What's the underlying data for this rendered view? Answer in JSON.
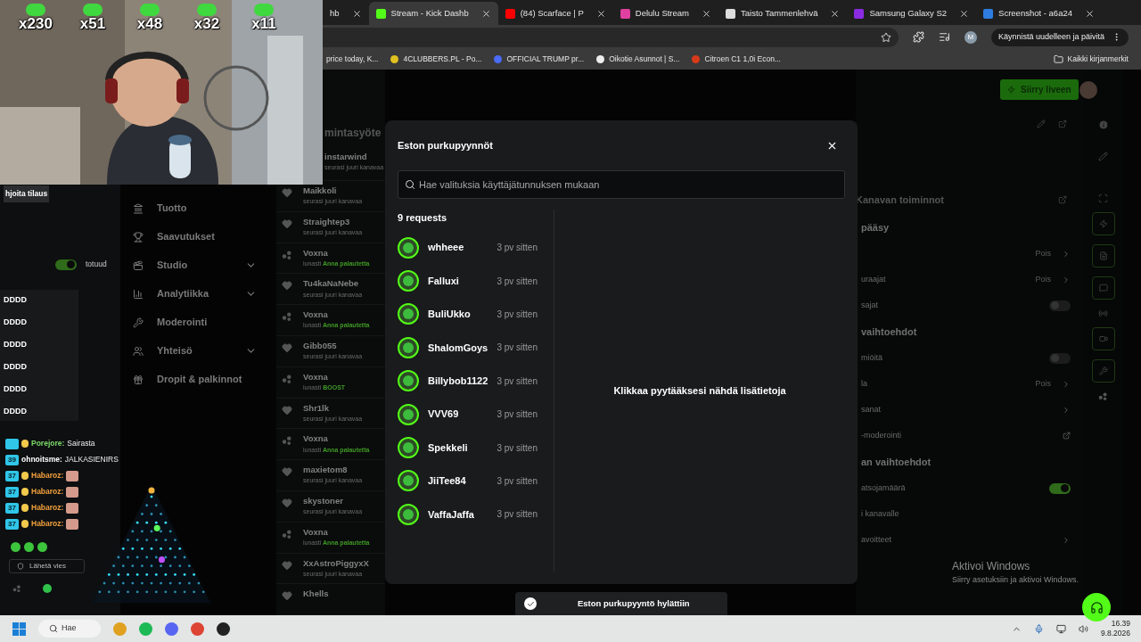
{
  "browser": {
    "tabs": [
      {
        "title": "hb",
        "selected": false
      },
      {
        "title": "Stream - Kick Dashb",
        "selected": true
      },
      {
        "title": "(84) Scarface | P",
        "selected": false
      },
      {
        "title": "Delulu Stream",
        "selected": false
      },
      {
        "title": "Taisto Tammenlehvä",
        "selected": false
      },
      {
        "title": "Samsung Galaxy S2",
        "selected": false
      },
      {
        "title": "Screenshot - a6a24",
        "selected": false
      }
    ],
    "update_button": "Käynnistä uudelleen ja päivitä",
    "profile_initial": "M",
    "bookmarks": [
      "price today, K...",
      "4CLUBBERS.PL - Po...",
      "OFFICIAL TRUMP pr...",
      "Oikotie Asunnot | S...",
      "Citroen C1 1,0i Econ..."
    ],
    "all_bookmarks": "Kaikki kirjanmerkit"
  },
  "webcam": {
    "counters": [
      "x230",
      "x51",
      "x48",
      "x32",
      "x11"
    ]
  },
  "chat_panel": {
    "popup": "hjoita tilaus",
    "toggle_on": true,
    "side_text": "totuud",
    "list": [
      "DDDD",
      "DDDD",
      "DDDD",
      "DDDD",
      "DDDD",
      "DDDD"
    ],
    "messages": [
      {
        "user": "Porejore:",
        "text": "Sairasta",
        "color": "#7cd96a"
      },
      {
        "badge": "39",
        "user": "ohnoitsme:",
        "text": "JALKASIENIRS",
        "color": "#ffffff"
      },
      {
        "badge": "37",
        "user": "Habaroz:",
        "color": "#f2a03d"
      },
      {
        "badge": "37",
        "user": "Habaroz:",
        "color": "#f2a03d"
      },
      {
        "badge": "37",
        "user": "Habaroz:",
        "color": "#f2a03d"
      },
      {
        "badge": "37",
        "user": "Habaroz:",
        "color": "#f2a03d"
      }
    ],
    "input_placeholder": "Lähetä vies"
  },
  "nav": [
    {
      "label": "Tuotto",
      "expandable": false
    },
    {
      "label": "Saavutukset",
      "expandable": false
    },
    {
      "label": "Studio",
      "expandable": true
    },
    {
      "label": "Analytiikka",
      "expandable": true
    },
    {
      "label": "Moderointi",
      "expandable": false
    },
    {
      "label": "Yhteisö",
      "expandable": true
    },
    {
      "label": "Dropit & palkinnot",
      "expandable": false
    }
  ],
  "activity": {
    "title": "mintasyöte",
    "items": [
      {
        "kind": "follow",
        "user": "instarwind",
        "text": "seurasi juuri kanavaa"
      },
      {
        "kind": "follow",
        "user": "Maikkoli",
        "text": "seurasi juuri kanavaa"
      },
      {
        "kind": "follow",
        "user": "Straightep3",
        "text": "seurasi juuri kanavaa"
      },
      {
        "kind": "redeem",
        "user": "Voxna",
        "text": "lunasti",
        "reward": "Anna palautetta"
      },
      {
        "kind": "follow",
        "user": "Tu4kaNaNebe",
        "text": "seurasi juuri kanavaa"
      },
      {
        "kind": "redeem",
        "user": "Voxna",
        "text": "lunasti",
        "reward": "Anna palautetta"
      },
      {
        "kind": "follow",
        "user": "Gibb055",
        "text": "seurasi juuri kanavaa"
      },
      {
        "kind": "redeem",
        "user": "Voxna",
        "text": "lunasti",
        "reward": "BOOST"
      },
      {
        "kind": "follow",
        "user": "Shr1lk",
        "text": "seurasi juuri kanavaa"
      },
      {
        "kind": "redeem",
        "user": "Voxna",
        "text": "lunasti",
        "reward": "Anna palautetta"
      },
      {
        "kind": "follow",
        "user": "maxietom8",
        "text": "seurasi juuri kanavaa"
      },
      {
        "kind": "follow",
        "user": "skystoner",
        "text": "seurasi juuri kanavaa"
      },
      {
        "kind": "redeem",
        "user": "Voxna",
        "text": "lunasti",
        "reward": "Anna palautetta"
      },
      {
        "kind": "follow",
        "user": "XxAstroPiggyxX",
        "text": "seurasi juuri kanavaa"
      },
      {
        "kind": "follow",
        "user": "Khells"
      }
    ]
  },
  "go_live": "Siirry liveen",
  "modal": {
    "title": "Eston purkupyynnöt",
    "search_placeholder": "Hae valituksia käyttäjätunnuksen mukaan",
    "count": "9 requests",
    "requests": [
      {
        "user": "whheee",
        "time": "3 pv sitten"
      },
      {
        "user": "Falluxi",
        "time": "3 pv sitten"
      },
      {
        "user": "BuliUkko",
        "time": "3 pv sitten"
      },
      {
        "user": "ShalomGoys",
        "time": "3 pv sitten"
      },
      {
        "user": "Billybob1122",
        "time": "3 pv sitten"
      },
      {
        "user": "VVV69",
        "time": "3 pv sitten"
      },
      {
        "user": "Spekkeli",
        "time": "3 pv sitten"
      },
      {
        "user": "JiiTee84",
        "time": "3 pv sitten"
      },
      {
        "user": "VaffaJaffa",
        "time": "3 pv sitten"
      }
    ],
    "empty_hint": "Klikkaa pyytääksesi nähdä lisätietoja"
  },
  "settings": {
    "title": "Kanavan toiminnot",
    "rows": [
      {
        "kind": "heading",
        "label": "pääsy"
      },
      {
        "kind": "value",
        "value": "Pois"
      },
      {
        "kind": "value",
        "label": "uraajat",
        "value": "Pois"
      },
      {
        "kind": "toggle",
        "label": "sajat",
        "on": false
      },
      {
        "kind": "heading",
        "label": "vaihtoehdot"
      },
      {
        "kind": "toggle",
        "label": "miöitä",
        "on": false
      },
      {
        "kind": "value",
        "label": "la",
        "value": "Pois"
      },
      {
        "kind": "link",
        "label": "sanat"
      },
      {
        "kind": "external",
        "label": "-moderointi"
      },
      {
        "kind": "heading",
        "label": "an vaihtoehdot"
      },
      {
        "kind": "toggle",
        "label": "atsojamäärä",
        "on": true
      },
      {
        "kind": "plain",
        "label": "i kanavalle"
      },
      {
        "kind": "link",
        "label": "avoitteet"
      }
    ]
  },
  "activation": {
    "title": "Aktivoi Windows",
    "subtitle": "Siirry asetuksiin ja aktivoi Windows."
  },
  "toast": {
    "text": "Eston purkupyyntö hylättiin"
  },
  "taskbar": {
    "search": "Hae",
    "time": "16.39",
    "date": "9.8.2026"
  }
}
